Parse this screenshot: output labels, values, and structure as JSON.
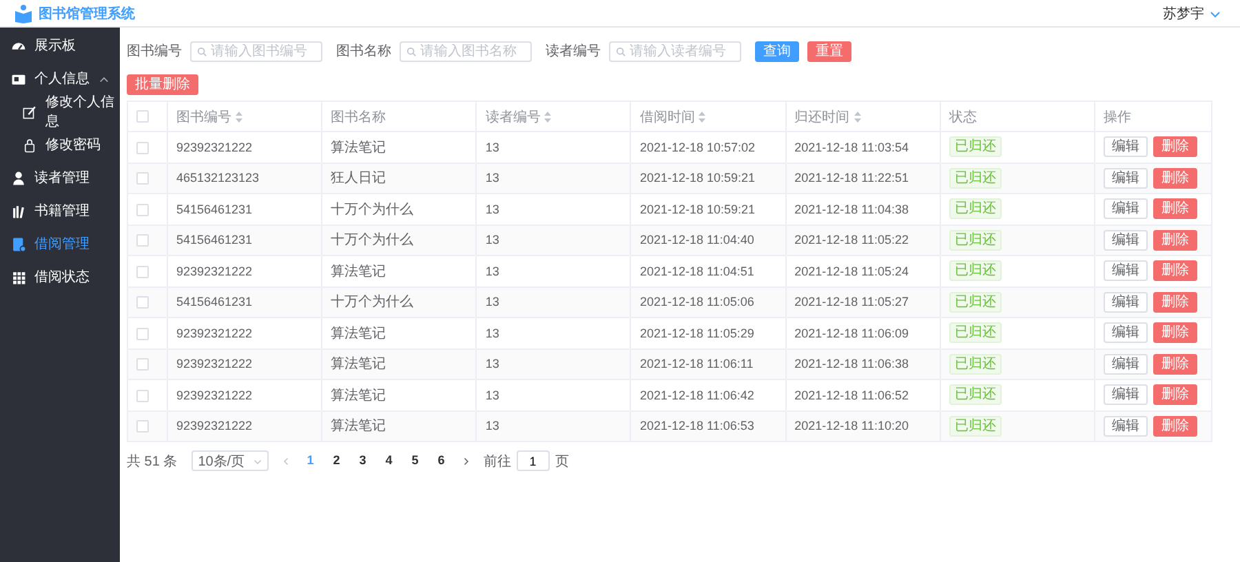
{
  "header": {
    "title": "图书馆管理系统",
    "user": "苏梦宇"
  },
  "sidebar": {
    "items": [
      {
        "label": "展示板",
        "selected": false
      },
      {
        "label": "个人信息",
        "selected": false,
        "expanded": true,
        "children": [
          {
            "label": "修改个人信息",
            "selected": false
          },
          {
            "label": "修改密码",
            "selected": false
          }
        ]
      },
      {
        "label": "读者管理",
        "selected": false
      },
      {
        "label": "书籍管理",
        "selected": false
      },
      {
        "label": "借阅管理",
        "selected": true
      },
      {
        "label": "借阅状态",
        "selected": false
      }
    ]
  },
  "filters": [
    {
      "label": "图书编号",
      "placeholder": "请输入图书编号"
    },
    {
      "label": "图书名称",
      "placeholder": "请输入图书名称"
    },
    {
      "label": "读者编号",
      "placeholder": "请输入读者编号"
    }
  ],
  "filter_buttons": [
    {
      "label": "查询",
      "kind": "primary"
    },
    {
      "label": "重置",
      "kind": "danger"
    }
  ],
  "batch_delete": "批量删除",
  "table": {
    "all_checked": false,
    "columns": [
      {
        "label": "图书编号",
        "sortable": true
      },
      {
        "label": "图书名称",
        "sortable": false
      },
      {
        "label": "读者编号",
        "sortable": true
      },
      {
        "label": "借阅时间",
        "sortable": true
      },
      {
        "label": "归还时间",
        "sortable": true
      },
      {
        "label": "状态",
        "sortable": false
      },
      {
        "label": "操作",
        "sortable": false
      }
    ],
    "rows": [
      {
        "checked": false,
        "cells": [
          "92392321222",
          "算法笔记",
          "13",
          "2021-12-18 10:57:02",
          "2021-12-18 11:03:54"
        ],
        "status": "已归还",
        "actions": [
          "编辑",
          "删除"
        ]
      },
      {
        "checked": false,
        "cells": [
          "465132123123",
          "狂人日记",
          "13",
          "2021-12-18 10:59:21",
          "2021-12-18 11:22:51"
        ],
        "status": "已归还",
        "actions": [
          "编辑",
          "删除"
        ]
      },
      {
        "checked": false,
        "cells": [
          "54156461231",
          "十万个为什么",
          "13",
          "2021-12-18 10:59:21",
          "2021-12-18 11:04:38"
        ],
        "status": "已归还",
        "actions": [
          "编辑",
          "删除"
        ]
      },
      {
        "checked": false,
        "cells": [
          "54156461231",
          "十万个为什么",
          "13",
          "2021-12-18 11:04:40",
          "2021-12-18 11:05:22"
        ],
        "status": "已归还",
        "actions": [
          "编辑",
          "删除"
        ]
      },
      {
        "checked": false,
        "cells": [
          "92392321222",
          "算法笔记",
          "13",
          "2021-12-18 11:04:51",
          "2021-12-18 11:05:24"
        ],
        "status": "已归还",
        "actions": [
          "编辑",
          "删除"
        ]
      },
      {
        "checked": false,
        "cells": [
          "54156461231",
          "十万个为什么",
          "13",
          "2021-12-18 11:05:06",
          "2021-12-18 11:05:27"
        ],
        "status": "已归还",
        "actions": [
          "编辑",
          "删除"
        ]
      },
      {
        "checked": false,
        "cells": [
          "92392321222",
          "算法笔记",
          "13",
          "2021-12-18 11:05:29",
          "2021-12-18 11:06:09"
        ],
        "status": "已归还",
        "actions": [
          "编辑",
          "删除"
        ]
      },
      {
        "checked": false,
        "cells": [
          "92392321222",
          "算法笔记",
          "13",
          "2021-12-18 11:06:11",
          "2021-12-18 11:06:38"
        ],
        "status": "已归还",
        "actions": [
          "编辑",
          "删除"
        ]
      },
      {
        "checked": false,
        "cells": [
          "92392321222",
          "算法笔记",
          "13",
          "2021-12-18 11:06:42",
          "2021-12-18 11:06:52"
        ],
        "status": "已归还",
        "actions": [
          "编辑",
          "删除"
        ]
      },
      {
        "checked": false,
        "cells": [
          "92392321222",
          "算法笔记",
          "13",
          "2021-12-18 11:06:53",
          "2021-12-18 11:10:20"
        ],
        "status": "已归还",
        "actions": [
          "编辑",
          "删除"
        ]
      }
    ]
  },
  "pagination": {
    "total": "共 51 条",
    "page_size": "10条/页",
    "pages": [
      {
        "label": "1",
        "selected": true
      },
      {
        "label": "2",
        "selected": false
      },
      {
        "label": "3",
        "selected": false
      },
      {
        "label": "4",
        "selected": false
      },
      {
        "label": "5",
        "selected": false
      },
      {
        "label": "6",
        "selected": false
      }
    ],
    "goto_label": "前往",
    "goto_value": "1",
    "goto_suffix": "页"
  }
}
